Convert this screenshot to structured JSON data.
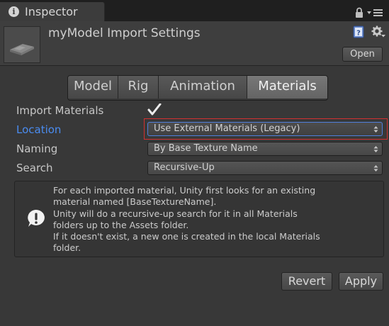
{
  "tab": {
    "icon": "info-icon",
    "title": "Inspector"
  },
  "header": {
    "title": "myModel Import Settings",
    "open_label": "Open"
  },
  "segments": [
    {
      "label": "Model",
      "active": false
    },
    {
      "label": "Rig",
      "active": false
    },
    {
      "label": "Animation",
      "active": false
    },
    {
      "label": "Materials",
      "active": true
    }
  ],
  "fields": {
    "import_materials": {
      "label": "Import Materials",
      "checked": true
    },
    "location": {
      "label": "Location",
      "value": "Use External Materials (Legacy)"
    },
    "naming": {
      "label": "Naming",
      "value": "By Base Texture Name"
    },
    "search": {
      "label": "Search",
      "value": "Recursive-Up"
    }
  },
  "helpbox": {
    "lines": [
      "For each imported material, Unity first looks for an existing",
      "material named [BaseTextureName].",
      "Unity will do a recursive-up search for it in all Materials",
      "folders up to the Assets folder.",
      "If it doesn't exist, a new one is created in the local Materials",
      "folder."
    ]
  },
  "buttons": {
    "revert": "Revert",
    "apply": "Apply"
  },
  "colors": {
    "accent_label": "#4a8cf0",
    "highlight": "#d43030",
    "background": "#383838"
  }
}
